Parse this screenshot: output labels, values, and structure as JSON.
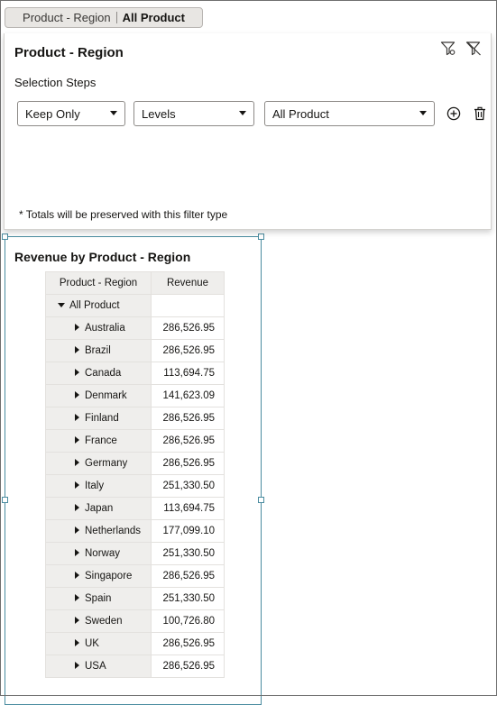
{
  "filter_pill": {
    "name": "Product - Region",
    "value": "All Product"
  },
  "filter_panel": {
    "title": "Product - Region",
    "selection_steps_label": "Selection Steps",
    "step": {
      "action": "Keep Only",
      "method": "Levels",
      "target": "All Product"
    },
    "footnote": "* Totals will be preserved with this filter type"
  },
  "viz": {
    "title": "Revenue by Product - Region",
    "columns": [
      "Product - Region",
      "Revenue"
    ],
    "root_label": "All Product",
    "rows": [
      {
        "label": "Australia",
        "value": "286,526.95"
      },
      {
        "label": "Brazil",
        "value": "286,526.95"
      },
      {
        "label": "Canada",
        "value": "113,694.75"
      },
      {
        "label": "Denmark",
        "value": "141,623.09"
      },
      {
        "label": "Finland",
        "value": "286,526.95"
      },
      {
        "label": "France",
        "value": "286,526.95"
      },
      {
        "label": "Germany",
        "value": "286,526.95"
      },
      {
        "label": "Italy",
        "value": "251,330.50"
      },
      {
        "label": "Japan",
        "value": "113,694.75"
      },
      {
        "label": "Netherlands",
        "value": "177,099.10"
      },
      {
        "label": "Norway",
        "value": "251,330.50"
      },
      {
        "label": "Singapore",
        "value": "286,526.95"
      },
      {
        "label": "Spain",
        "value": "251,330.50"
      },
      {
        "label": "Sweden",
        "value": "100,726.80"
      },
      {
        "label": "UK",
        "value": "286,526.95"
      },
      {
        "label": "USA",
        "value": "286,526.95"
      }
    ]
  },
  "icons": {
    "filter_settings": "filter-settings-icon",
    "clear_filter": "clear-filter-icon",
    "add_step": "add-circle-icon",
    "delete_step": "trash-icon"
  }
}
